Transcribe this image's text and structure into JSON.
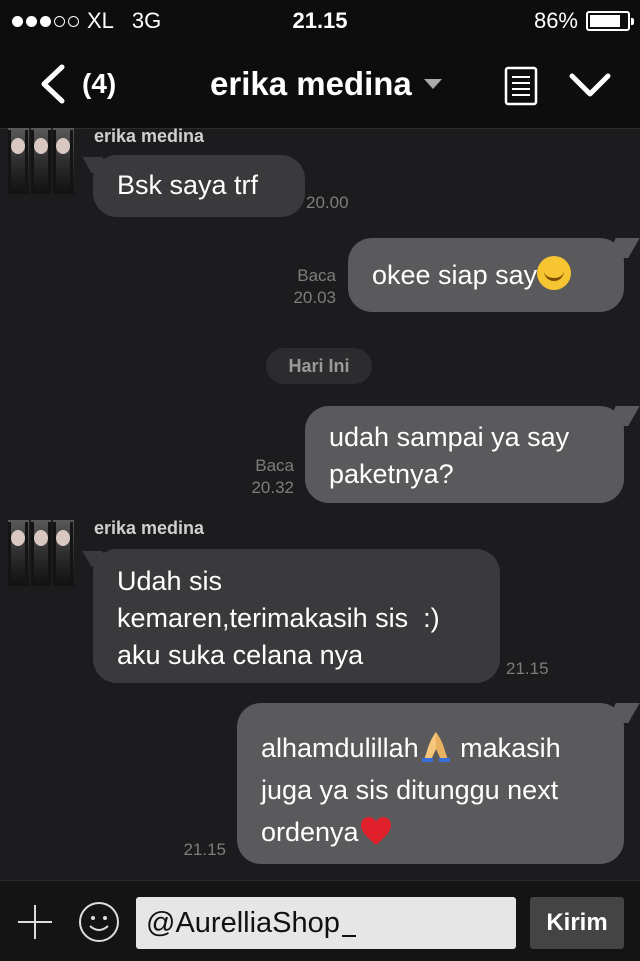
{
  "status_bar": {
    "carrier": "XL",
    "network": "3G",
    "time": "21.15",
    "battery_percent": "86%",
    "battery_level": 0.86,
    "signal_bars_filled": 3,
    "signal_bars_total": 5
  },
  "header": {
    "back_count": "(4)",
    "contact_name": "erika medina"
  },
  "messages": [
    {
      "direction": "in",
      "sender": "erika medina",
      "text": "Bsk saya trf",
      "time": "20.00"
    },
    {
      "direction": "out",
      "status": "Baca",
      "text": "okee siap say",
      "emoji": "smiling-face-icon",
      "time": "20.03"
    },
    {
      "direction": "out",
      "status": "Baca",
      "line1": "udah sampai ya say",
      "line2": "paketnya?",
      "time": "20.32"
    },
    {
      "direction": "in",
      "sender": "erika medina",
      "line1": "Udah sis",
      "line2": "kemaren,terimakasih sis  :)",
      "line3": "aku suka celana nya",
      "time": "21.15"
    },
    {
      "direction": "out",
      "line1": "alhamdulillah",
      "line1b": " makasih",
      "line2": "juga ya sis ditunggu next",
      "line3": "ordenya",
      "time": "21.15"
    }
  ],
  "day_separator": "Hari Ini",
  "input": {
    "value": "@AurelliaShop",
    "send_label": "Kirim"
  },
  "colors": {
    "background": "#1c1c1e",
    "bubble_in": "#3a3a3c",
    "bubble_out": "#5a5a5c"
  }
}
